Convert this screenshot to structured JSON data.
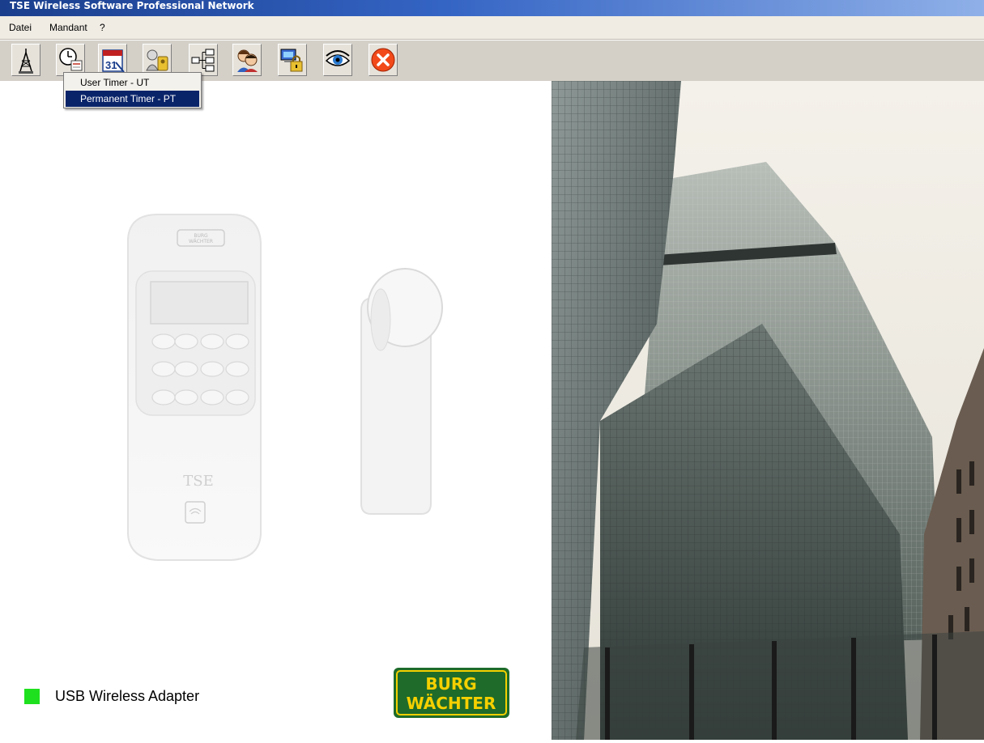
{
  "window": {
    "title": "TSE Wireless Software Professional Network"
  },
  "menu": {
    "items": [
      "Datei",
      "Mandant",
      "?"
    ]
  },
  "toolbar": {
    "buttons": [
      {
        "icon": "antenna-tower-icon"
      },
      {
        "icon": "timer-clock-icon"
      },
      {
        "icon": "calendar-icon"
      },
      {
        "icon": "user-keys-icon"
      },
      {
        "icon": "network-tree-icon"
      },
      {
        "icon": "users-icon"
      },
      {
        "icon": "computer-lock-icon"
      },
      {
        "icon": "eye-icon"
      },
      {
        "icon": "exit-icon"
      }
    ]
  },
  "dropdown": {
    "items": [
      "User Timer - UT",
      "Permanent Timer - PT"
    ],
    "selected_index": 1
  },
  "device": {
    "brand_label": "BURG WÄCHTER",
    "logo_text": "TSE"
  },
  "status": {
    "label": "USB Wireless Adapter",
    "indicator_color": "#1fe01f"
  },
  "brand_logo": {
    "line1": "BURG",
    "line2": "WÄCHTER"
  },
  "colors": {
    "selection": "#0a246a",
    "title_bar": "#1a3e8c",
    "logo_green": "#1e6b2a",
    "logo_yellow": "#f5d000"
  }
}
